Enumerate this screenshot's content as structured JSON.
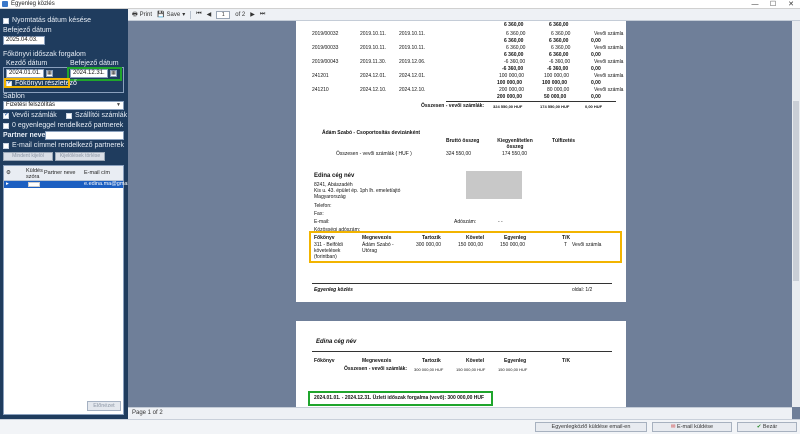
{
  "window": {
    "title": "Egyenleg közlés",
    "min": "—",
    "max": "☐",
    "close": "✕"
  },
  "left": {
    "chk_due_date": "Nyomtatás dátum késése",
    "end_date_label": "Befejező dátum",
    "end_date_value": "2025.04.03.",
    "ledger_group_label": "Főkönyvi időszak forgalom",
    "start_label": "Kezdő dátum",
    "end_label": "Befejező dátum",
    "start_value": "2024.01.01.",
    "end_value": "2024.12.31.",
    "chk_ledger": "Főkönyvi részletező",
    "template_label": "Sablon",
    "template_value": "Fizetési felszólítás",
    "chk_customer": "Vevői számlák",
    "chk_supplier": "Szállítói számlák",
    "chk_zero_balance": "0 egyenleggel rendelkező partnerek",
    "partner_name_label": "Partner neve",
    "partner_name_value": "",
    "chk_email": "E-mail címmel rendelkező partnerek",
    "btn_select_all": "Mindent kijelöl",
    "btn_clear": "Kijelölések törlése",
    "grid": {
      "col_send": "Küldés szóra",
      "col_partner": "Partner neve",
      "col_email": "E-mail cím",
      "row_email": "e.edina.ma@gmail.com"
    },
    "btn_preview": "Előnézet"
  },
  "toolbar": {
    "print": "Print",
    "save": "Save",
    "page_value": "1",
    "page_of": "of 2"
  },
  "status": "Page 1 of 2",
  "report": {
    "invoices": [
      {
        "id": "2019/00032",
        "date": "2019.10.11.",
        "due": "2019.10.11.",
        "gross": "6 360,00",
        "net": "6 360,00",
        "zero": "0,00",
        "type": "Vevői számla"
      },
      {
        "id": "2019/00033",
        "date": "2019.10.11.",
        "due": "2019.10.11.",
        "gross": "6 360,00",
        "net": "6 360,00",
        "zero": "0,00",
        "type": "Vevői számla"
      },
      {
        "id": "2019/00043",
        "date": "2019.11.30.",
        "due": "2019.12.06.",
        "gross": "-6 360,00",
        "net": "-6 360,00",
        "zero": "0,00",
        "type": "Vevői számla"
      },
      {
        "id": "241201",
        "date": "2024.12.01.",
        "due": "2024.12.01.",
        "gross": "100 000,00",
        "net": "100 000,00",
        "zero": "0,00",
        "type": "Vevői számla"
      },
      {
        "id": "241210",
        "date": "2024.12.10.",
        "due": "2024.12.10.",
        "gross": "200 000,00",
        "net": "80 000,00",
        "zero": "0,00",
        "type": "Vevői számla"
      }
    ],
    "top_gross": "6 360,00",
    "top_net": "6 360,00",
    "sub_rows": [
      "6 360,00",
      "-6 360,00",
      "100 000,00",
      "200 000,00"
    ],
    "sub_rows_net": [
      "6 360,00",
      "-6 360,00",
      "100 000,00",
      "50 000,00"
    ],
    "sum_label": "Összesen - vevői számlák:",
    "sum_gross": "324 550,00 HUF",
    "sum_net": "174 550,00 HUF",
    "sum_zero": "0,00 HUF",
    "partner_title": "Ádám Szabó - Csoportosítás devizánként",
    "col_gross": "Bruttó összeg",
    "col_outstanding": "Kiegyenlítetlen összeg",
    "col_overdue": "Túlfizetés",
    "group_label": "Összesen - vevői számlák ( HUF )",
    "group_gross": "324 550,00",
    "group_net": "174 550,00",
    "company_name": "Edina cég név",
    "addr1": "8241, Abászadéh",
    "addr2": "Kis u. 43. épület ép. 1ph lh. emelet/ajtó",
    "addr3": "Magyarország",
    "phone": "Telefon:",
    "fax": "Fax:",
    "email": "E-mail:",
    "tax_label": "Adószám:",
    "tax_value": "- -",
    "community_tax": "Közösségi adószám:",
    "ledger_hdr": {
      "a": "Főkönyv",
      "b": "Megnevezés",
      "c": "Tartozik",
      "d": "Követel",
      "e": "Egyenleg",
      "f": "T/K"
    },
    "ledger_row": {
      "a1": "311 - Belföldi",
      "a2": "követelések",
      "a3": "(forintban)",
      "b1": "Ádám Szabó -",
      "b2": "Utórag",
      "c": "300 000,00",
      "d": "150 000,00",
      "e": "150 000,00",
      "f": "T",
      "g": "Vevői számla"
    },
    "footer_left": "Egyenleg közlés",
    "footer_right": "oldal: 1/2",
    "p2_company": "Edina cég név",
    "p2_hdr": {
      "a": "Főkönyv",
      "b": "Megnevezés",
      "c": "Tartozik",
      "d": "Követel",
      "e": "Egyenleg",
      "f": "T/K"
    },
    "p2_sum_label": "Összesen - vevői számlák:",
    "p2_c": "300 000,00 HUF",
    "p2_d": "150 000,00 HUF",
    "p2_e": "150 000,00 HUF",
    "p2_period": "2024.01.01. - 2024.12.31. Üzleti időszak forgalma (vevő): 300 000,00 HUF"
  },
  "bottom": {
    "send_email": "Egyenlegközlő küldése email-en",
    "email_send": "E-mail küldése",
    "close": "Bezár"
  },
  "colors": {
    "panel": "#1f3c5e",
    "viewer_bg": "#6f7f99",
    "highlight_green": "#1fa52c",
    "highlight_yellow": "#f2b400",
    "row_selected": "#1c5fc1"
  }
}
